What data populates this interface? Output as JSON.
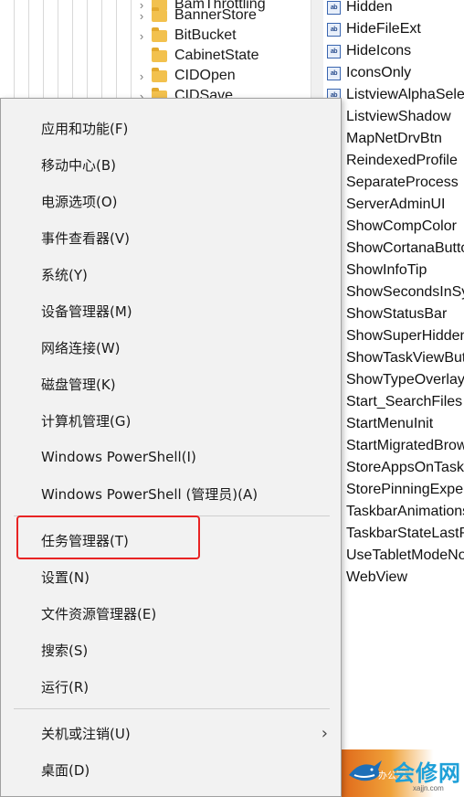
{
  "registry_tree": {
    "items": [
      {
        "label": "BamThrottling",
        "has_children": true
      },
      {
        "label": "BannerStore",
        "has_children": true
      },
      {
        "label": "BitBucket",
        "has_children": true
      },
      {
        "label": "CabinetState",
        "has_children": false
      },
      {
        "label": "CIDOpen",
        "has_children": true
      },
      {
        "label": "CIDSave",
        "has_children": true
      }
    ]
  },
  "registry_values": {
    "icon_label": "ab",
    "items": [
      "Hidden",
      "HideFileExt",
      "HideIcons",
      "IconsOnly",
      "ListviewAlphaSelect",
      "ListviewShadow",
      "MapNetDrvBtn",
      "ReindexedProfile",
      "SeparateProcess",
      "ServerAdminUI",
      "ShowCompColor",
      "ShowCortanaButton",
      "ShowInfoTip",
      "ShowSecondsInSystemClock",
      "ShowStatusBar",
      "ShowSuperHidden",
      "ShowTaskViewButton",
      "ShowTypeOverlay",
      "Start_SearchFiles",
      "StartMenuInit",
      "StartMigratedBrowserPin",
      "StoreAppsOnTaskbar",
      "StorePinningExperience",
      "TaskbarAnimations",
      "TaskbarStateLastRun",
      "UseTabletModeNotification",
      "WebView"
    ]
  },
  "context_menu": {
    "items": [
      "应用和功能(F)",
      "移动中心(B)",
      "电源选项(O)",
      "事件查看器(V)",
      "系统(Y)",
      "设备管理器(M)",
      "网络连接(W)",
      "磁盘管理(K)",
      "计算机管理(G)",
      "Windows PowerShell(I)",
      "Windows PowerShell (管理员)(A)",
      "任务管理器(T)",
      "设置(N)",
      "文件资源管理器(E)",
      "搜索(S)",
      "运行(R)",
      "关机或注销(U)",
      "桌面(D)"
    ],
    "highlighted_item": "任务管理器(T)",
    "highlight_color": "#e82424",
    "submenu_arrow_icon": "chevron-right-icon"
  },
  "watermark": {
    "text": "会修网",
    "url": "xajjn.com",
    "caption": "办公室"
  }
}
